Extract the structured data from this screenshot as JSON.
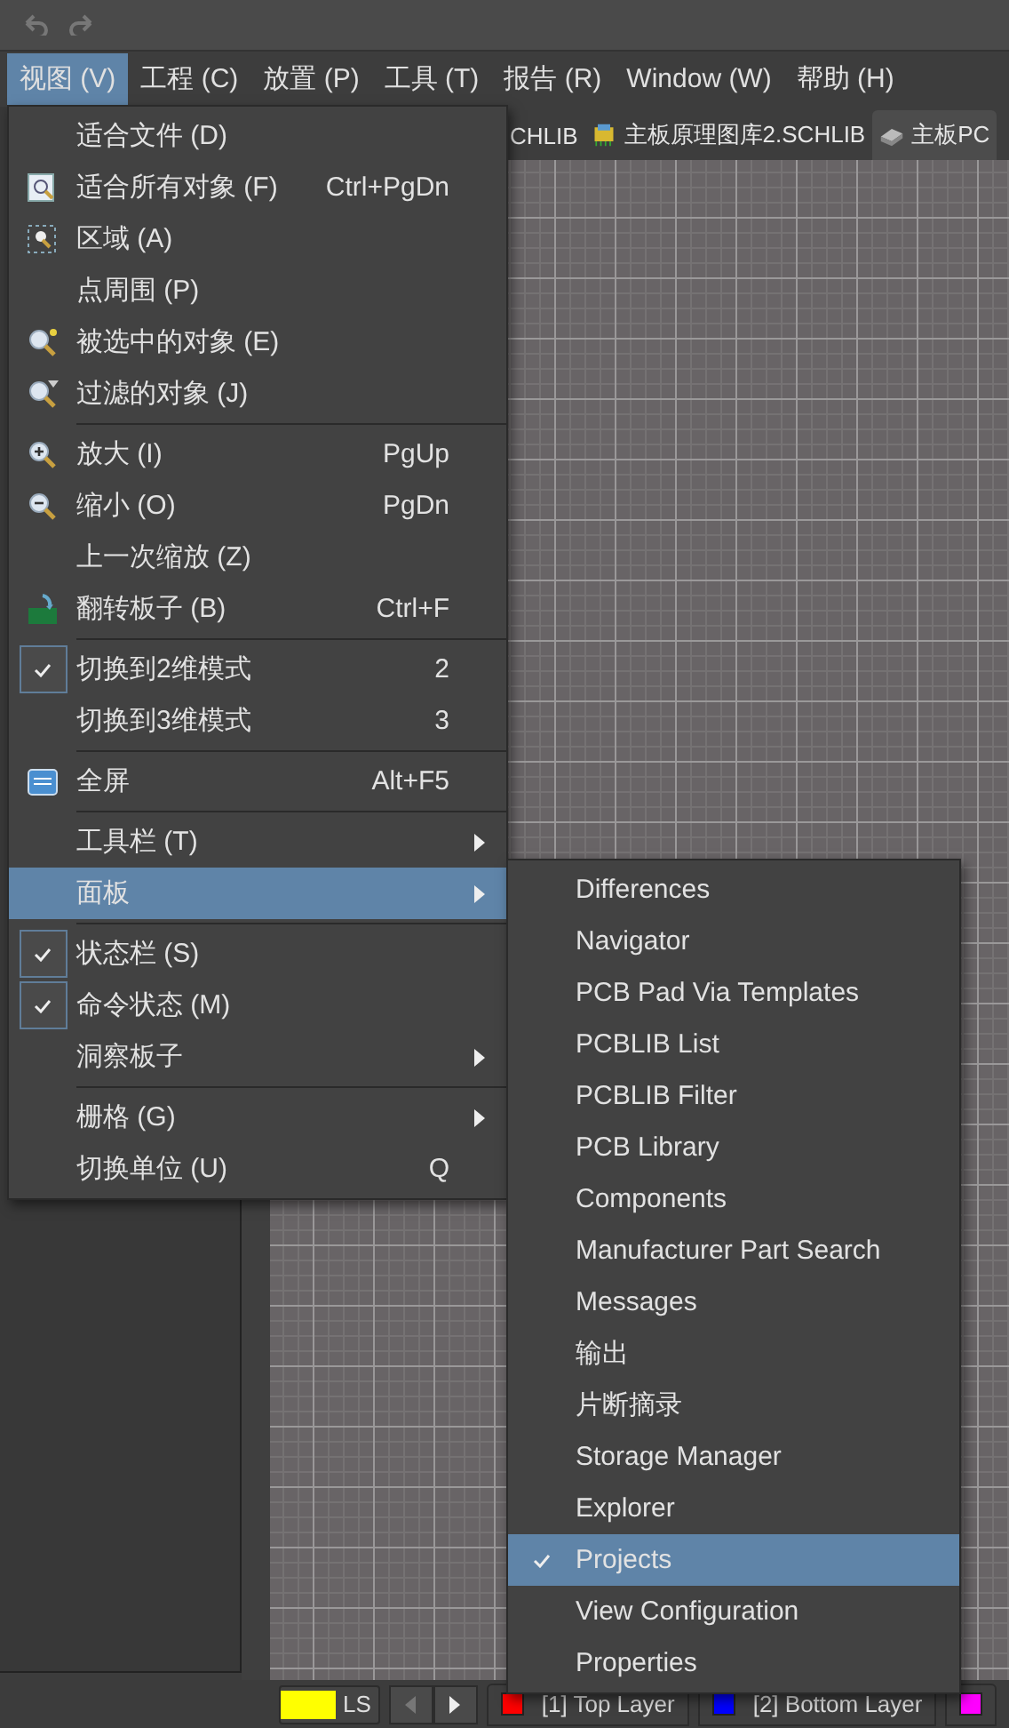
{
  "menubar": [
    {
      "label": "视图 (V)",
      "selected": true
    },
    {
      "label": "工程 (C)",
      "selected": false
    },
    {
      "label": "放置 (P)",
      "selected": false
    },
    {
      "label": "工具 (T)",
      "selected": false
    },
    {
      "label": "报告 (R)",
      "selected": false
    },
    {
      "label": "Window (W)",
      "selected": false
    },
    {
      "label": "帮助 (H)",
      "selected": false
    }
  ],
  "document_tabs": [
    {
      "label": "CHLIB",
      "kind": "none",
      "selected": false
    },
    {
      "label": "主板原理图库2.SCHLIB",
      "kind": "schlib",
      "selected": false
    },
    {
      "label": "主板PC",
      "kind": "pcb",
      "selected": true
    }
  ],
  "view_menu": [
    {
      "kind": "item",
      "label": "适合文件 (D)",
      "checked": false,
      "submenu": false,
      "selected": false
    },
    {
      "kind": "item",
      "label": "适合所有对象 (F)",
      "shortcut": "Ctrl+PgDn",
      "checked": false,
      "submenu": false,
      "selected": false
    },
    {
      "kind": "item",
      "label": "区域 (A)",
      "checked": false,
      "submenu": false,
      "selected": false
    },
    {
      "kind": "item",
      "label": "点周围 (P)",
      "checked": false,
      "submenu": false,
      "selected": false
    },
    {
      "kind": "item",
      "label": "被选中的对象 (E)",
      "checked": false,
      "submenu": false,
      "selected": false
    },
    {
      "kind": "item",
      "label": "过滤的对象 (J)",
      "checked": false,
      "submenu": false,
      "selected": false
    },
    {
      "kind": "separator"
    },
    {
      "kind": "item",
      "label": "放大 (I)",
      "shortcut": "PgUp",
      "checked": false,
      "submenu": false,
      "selected": false
    },
    {
      "kind": "item",
      "label": "缩小 (O)",
      "shortcut": "PgDn",
      "checked": false,
      "submenu": false,
      "selected": false
    },
    {
      "kind": "item",
      "label": "上一次缩放 (Z)",
      "checked": false,
      "submenu": false,
      "selected": false
    },
    {
      "kind": "item",
      "label": "翻转板子 (B)",
      "shortcut": "Ctrl+F",
      "checked": false,
      "submenu": false,
      "selected": false
    },
    {
      "kind": "separator"
    },
    {
      "kind": "item",
      "label": "切换到2维模式",
      "shortcut": "2",
      "checked": true,
      "submenu": false,
      "selected": false
    },
    {
      "kind": "item",
      "label": "切换到3维模式",
      "shortcut": "3",
      "checked": false,
      "submenu": false,
      "selected": false
    },
    {
      "kind": "separator"
    },
    {
      "kind": "item",
      "label": "全屏",
      "shortcut": "Alt+F5",
      "checked": false,
      "submenu": false,
      "selected": false
    },
    {
      "kind": "separator"
    },
    {
      "kind": "item",
      "label": "工具栏 (T)",
      "checked": false,
      "submenu": true,
      "selected": false
    },
    {
      "kind": "item",
      "label": "面板",
      "checked": false,
      "submenu": true,
      "selected": true
    },
    {
      "kind": "separator"
    },
    {
      "kind": "item",
      "label": "状态栏 (S)",
      "checked": true,
      "submenu": false,
      "selected": false
    },
    {
      "kind": "item",
      "label": "命令状态 (M)",
      "checked": true,
      "submenu": false,
      "selected": false
    },
    {
      "kind": "item",
      "label": "洞察板子",
      "checked": false,
      "submenu": true,
      "selected": false
    },
    {
      "kind": "separator"
    },
    {
      "kind": "item",
      "label": "栅格 (G)",
      "checked": false,
      "submenu": true,
      "selected": false
    },
    {
      "kind": "item",
      "label": "切换单位 (U)",
      "shortcut": "Q",
      "checked": false,
      "submenu": false,
      "selected": false
    }
  ],
  "panels_submenu": [
    {
      "label": "Differences",
      "checked": false,
      "selected": false
    },
    {
      "label": "Navigator",
      "checked": false,
      "selected": false
    },
    {
      "label": "PCB Pad Via Templates",
      "checked": false,
      "selected": false
    },
    {
      "label": "PCBLIB List",
      "checked": false,
      "selected": false
    },
    {
      "label": "PCBLIB Filter",
      "checked": false,
      "selected": false
    },
    {
      "label": "PCB Library",
      "checked": false,
      "selected": false
    },
    {
      "label": "Components",
      "checked": false,
      "selected": false
    },
    {
      "label": "Manufacturer Part Search",
      "checked": false,
      "selected": false
    },
    {
      "label": "Messages",
      "checked": false,
      "selected": false
    },
    {
      "label": "输出",
      "checked": false,
      "selected": false
    },
    {
      "label": "片断摘录",
      "checked": false,
      "selected": false
    },
    {
      "label": "Storage Manager",
      "checked": false,
      "selected": false
    },
    {
      "label": "Explorer",
      "checked": false,
      "selected": false
    },
    {
      "label": "Projects",
      "checked": true,
      "selected": true
    },
    {
      "label": "View Configuration",
      "checked": false,
      "selected": false
    },
    {
      "label": "Properties",
      "checked": false,
      "selected": false
    }
  ],
  "status_bar": {
    "current_layer": {
      "label": "LS",
      "color": "#ffff00"
    },
    "layers": [
      {
        "label": "[1] Top Layer",
        "color": "#ff0000"
      },
      {
        "label": "[2] Bottom Layer",
        "color": "#0000ff"
      },
      {
        "color": "#ff00ff"
      }
    ]
  }
}
